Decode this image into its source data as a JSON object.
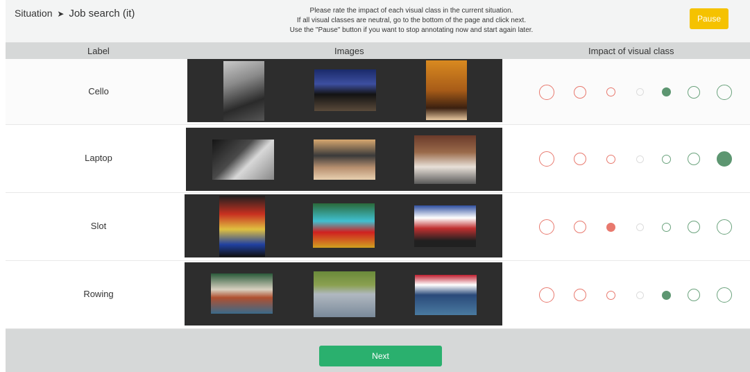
{
  "header": {
    "breadcrumb_root": "Situation",
    "breadcrumb_sep": "➤",
    "breadcrumb_page": "Job search (it)",
    "instructions": [
      "Please rate the impact of each visual class in the current situation.",
      "If all visual classes are neutral, go to the bottom of the page and click next.",
      "Use the \"Pause\" button if you want to stop annotating now and start again later."
    ],
    "pause_label": "Pause"
  },
  "columns": {
    "label": "Label",
    "images": "Images",
    "impact": "Impact of visual class"
  },
  "colors": {
    "negative": "#e8796e",
    "neutral": "#dcdcdc",
    "positive": "#6aa27c",
    "positive_fill": "#5d9671",
    "pause": "#f5c200",
    "next": "#2ab06e"
  },
  "scale_points": 7,
  "rows": [
    {
      "label": "Cello",
      "selected": 4,
      "thumbs": [
        {
          "name": "cellist-bw-photo",
          "bg": "linear-gradient(160deg,#c9c9c9 0%,#8a8a8a 35%,#2a2a2a 70%,#555 100%)"
        },
        {
          "name": "orchestra-concert-photo",
          "bg": "linear-gradient(180deg,#1a2a6a 0%,#3d4fa0 35%,#131313 60%,#5a4a3a 100%)"
        },
        {
          "name": "cellist-stage-photo",
          "bg": "linear-gradient(180deg,#d98a20 0%,#a85c18 50%,#3b2010 80%,#e8c8a0 100%)"
        }
      ]
    },
    {
      "label": "Laptop",
      "selected": 6,
      "thumbs": [
        {
          "name": "laptop-keyboard-bw-photo",
          "bg": "linear-gradient(135deg,#151515 0%,#4a4a4a 40%,#d8d8d8 60%,#888 100%)"
        },
        {
          "name": "open-laptop-photo",
          "bg": "linear-gradient(180deg,#d8a870 0%,#3a3a3a 40%,#b89070 70%,#e8d0b0 100%)"
        },
        {
          "name": "woman-at-laptop-photo",
          "bg": "linear-gradient(180deg,#6a3a2a 0%,#9a6a4a 35%,#e8e0d8 65%,#5a5a5a 100%)"
        }
      ]
    },
    {
      "label": "Slot",
      "selected": 2,
      "thumbs": [
        {
          "name": "slot-machine-photo",
          "bg": "linear-gradient(180deg,#202020 0%,#c83020 30%,#e0c040 55%,#2040a0 80%,#101010 100%)"
        },
        {
          "name": "slot-game-screen-photo",
          "bg": "linear-gradient(180deg,#2a6a3a 0%,#40c0d0 40%,#d02020 65%,#d0a020 100%)"
        },
        {
          "name": "slot-reels-photo",
          "bg": "linear-gradient(180deg,#3050a0 0%,#ffffff 30%,#c03030 55%,#202020 85%)"
        }
      ]
    },
    {
      "label": "Rowing",
      "selected": 4,
      "thumbs": [
        {
          "name": "rowers-closeup-photo",
          "bg": "linear-gradient(180deg,#2a5a3a 0%,#d8d0c0 40%,#b05030 60%,#3a6a8a 100%)"
        },
        {
          "name": "rowing-lake-photo",
          "bg": "linear-gradient(180deg,#6a8a3a 0%,#8aa050 30%,#b0b8c0 50%,#7a8a9a 100%)"
        },
        {
          "name": "rowing-race-photo",
          "bg": "linear-gradient(180deg,#c02030 0%,#ffffff 25%,#2a4a7a 50%,#4a7aa0 100%)"
        }
      ]
    }
  ],
  "footer": {
    "next_label": "Next"
  }
}
